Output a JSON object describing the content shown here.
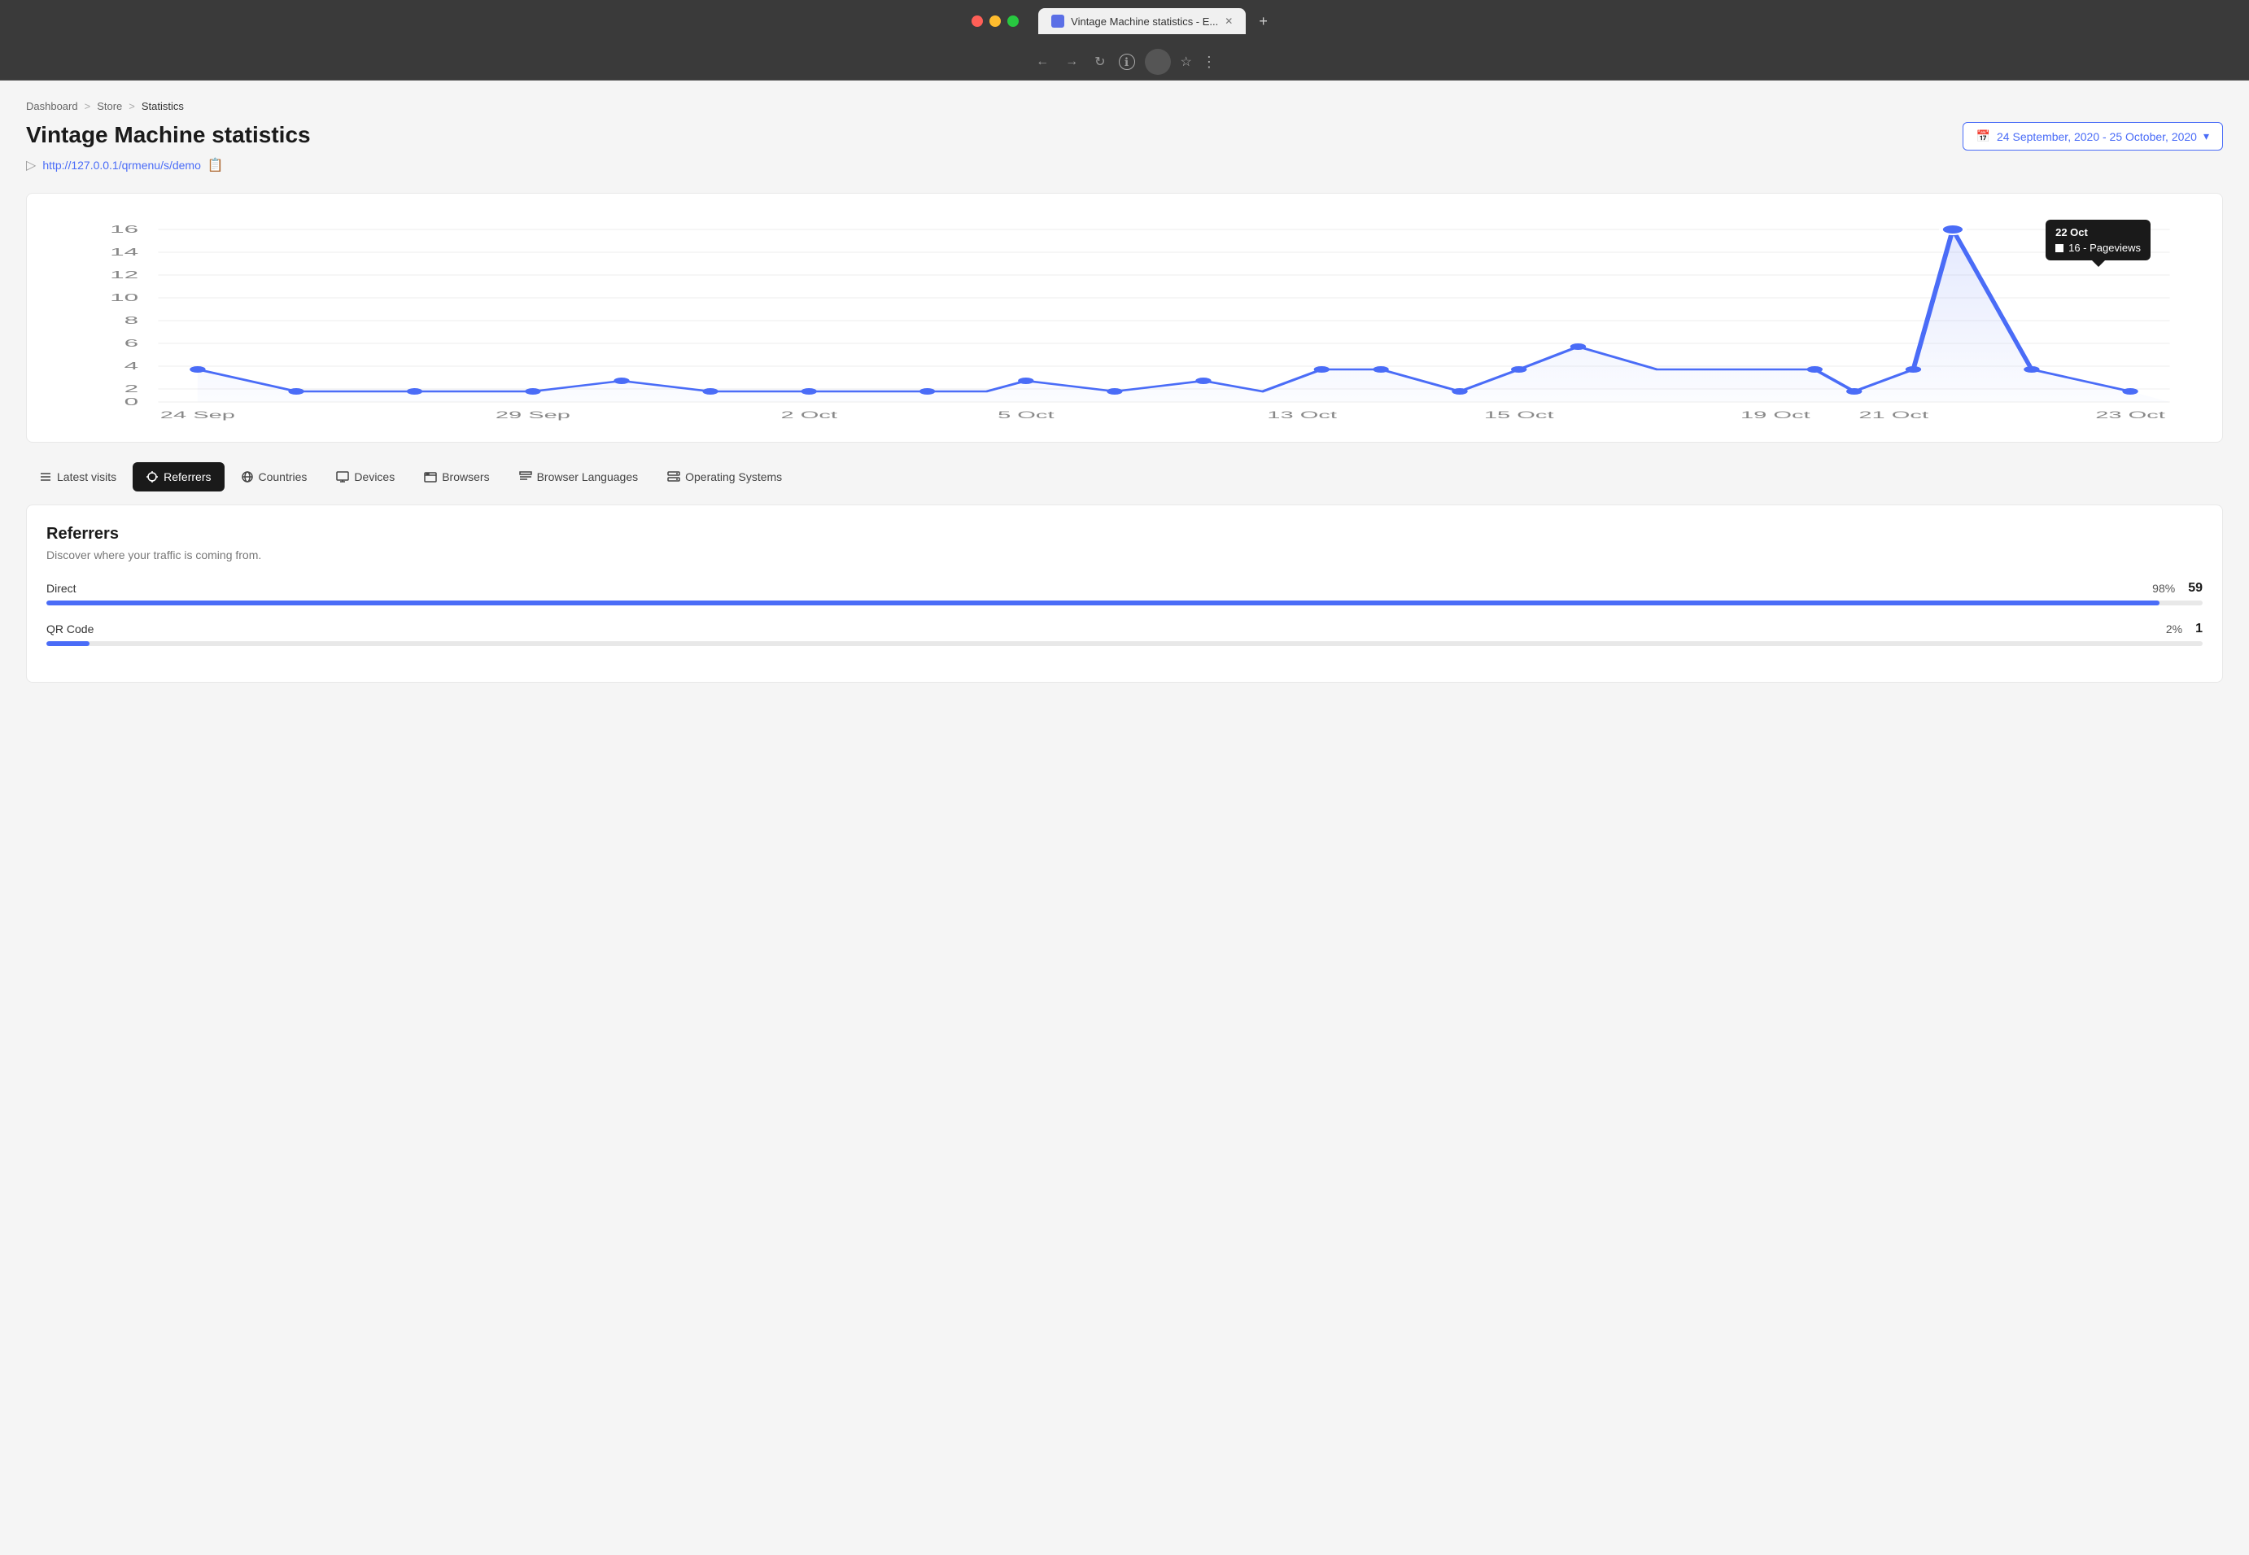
{
  "browser": {
    "tab_title": "Vintage Machine statistics - E...",
    "address": "",
    "new_tab_label": "+"
  },
  "breadcrumb": {
    "items": [
      "Dashboard",
      "Store",
      "Statistics"
    ],
    "separators": [
      ">",
      ">"
    ]
  },
  "header": {
    "title": "Vintage Machine statistics",
    "url": "http://127.0.0.1/qrmenu/s/demo",
    "date_range": "24 September, 2020 - 25 October, 2020"
  },
  "chart": {
    "tooltip": {
      "date": "22 Oct",
      "value": "16",
      "label": "Pageviews"
    },
    "y_labels": [
      "0",
      "2",
      "4",
      "6",
      "8",
      "10",
      "12",
      "14",
      "16"
    ],
    "x_labels": [
      "24 Sep",
      "29 Sep",
      "2 Oct",
      "5 Oct",
      "13 Oct",
      "15 Oct",
      "19 Oct",
      "21 Oct",
      "23 Oct"
    ]
  },
  "tabs": [
    {
      "id": "latest-visits",
      "label": "Latest visits",
      "icon": "list"
    },
    {
      "id": "referrers",
      "label": "Referrers",
      "icon": "crosshair",
      "active": true
    },
    {
      "id": "countries",
      "label": "Countries",
      "icon": "globe"
    },
    {
      "id": "devices",
      "label": "Devices",
      "icon": "monitor"
    },
    {
      "id": "browsers",
      "label": "Browsers",
      "icon": "browser"
    },
    {
      "id": "browser-languages",
      "label": "Browser Languages",
      "icon": "text"
    },
    {
      "id": "operating-systems",
      "label": "Operating Systems",
      "icon": "server"
    }
  ],
  "referrers": {
    "title": "Referrers",
    "subtitle": "Discover where your traffic is coming from.",
    "items": [
      {
        "name": "Direct",
        "percent": 98,
        "count": 59
      },
      {
        "name": "QR Code",
        "percent": 2,
        "count": 1
      }
    ]
  }
}
